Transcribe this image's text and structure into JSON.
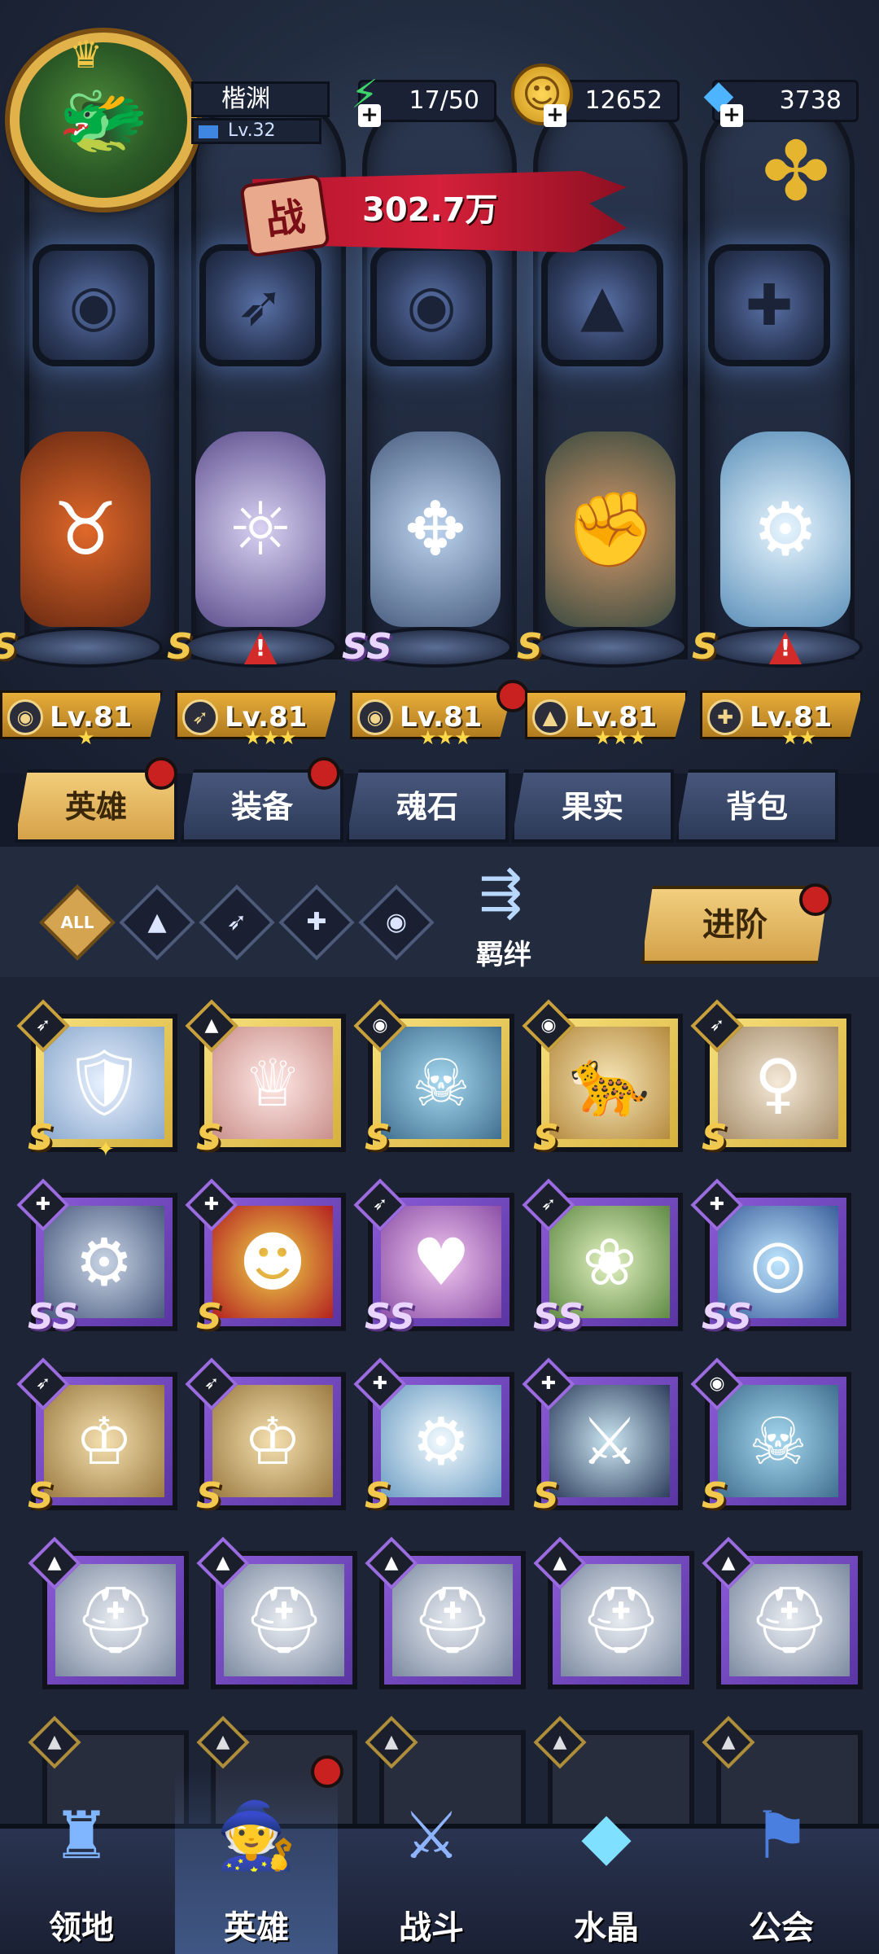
{
  "player": {
    "name": "楷渊",
    "level": "Lv.32"
  },
  "resources": {
    "stamina": "17/50",
    "gold": "12652",
    "diamonds": "3738"
  },
  "power": {
    "label": "战",
    "value": "302.7万"
  },
  "heroes": [
    {
      "grade": "S",
      "level": "Lv.81",
      "stars": "★",
      "alert": false
    },
    {
      "grade": "S",
      "level": "Lv.81",
      "stars": "★★★",
      "alert": true
    },
    {
      "grade": "SS",
      "level": "Lv.81",
      "stars": "★★★",
      "alert": false
    },
    {
      "grade": "S",
      "level": "Lv.81",
      "stars": "★★★",
      "alert": false
    },
    {
      "grade": "S",
      "level": "Lv.81",
      "stars": "★★",
      "alert": true
    }
  ],
  "tabs": [
    "英雄",
    "装备",
    "魂石",
    "果实",
    "背包"
  ],
  "filters": {
    "all": "ALL"
  },
  "bond_label": "羁绊",
  "advance_label": "进阶",
  "cards": [
    {
      "grade": "S"
    },
    {
      "grade": "S"
    },
    {
      "grade": "S"
    },
    {
      "grade": "S"
    },
    {
      "grade": "S"
    },
    {
      "grade": "SS"
    },
    {
      "grade": "S"
    },
    {
      "grade": "SS"
    },
    {
      "grade": "SS"
    },
    {
      "grade": "SS"
    },
    {
      "grade": "S"
    },
    {
      "grade": "S"
    },
    {
      "grade": "S"
    },
    {
      "grade": "S"
    },
    {
      "grade": "S"
    }
  ],
  "nav": [
    "领地",
    "英雄",
    "战斗",
    "水晶",
    "公会"
  ],
  "colors": {
    "gold": "#e7ad3a",
    "purple_card": "#6a42b8",
    "alert_red": "#c8211f",
    "power_red": "#c51a33"
  }
}
